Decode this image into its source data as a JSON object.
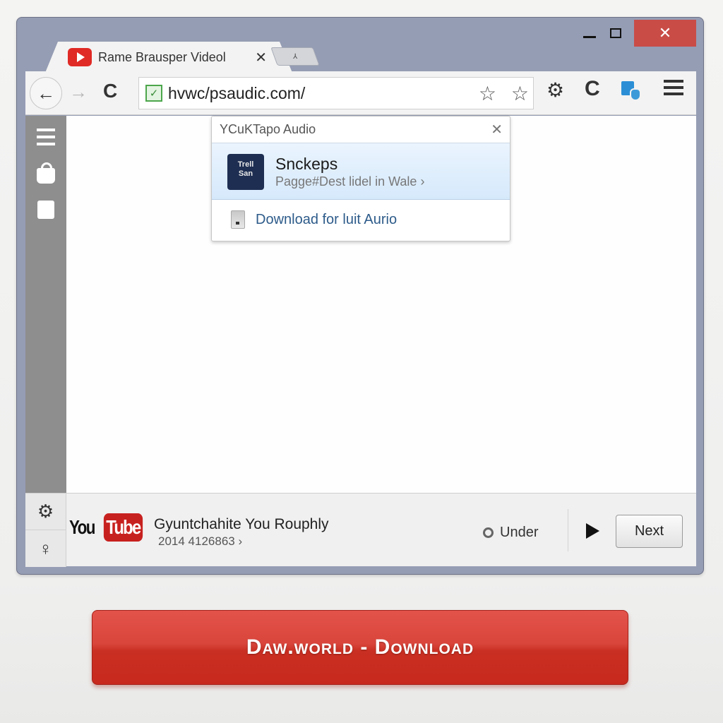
{
  "window": {
    "controls": {
      "minimize": "–",
      "maximize": "□",
      "close": "✕"
    }
  },
  "tabs": [
    {
      "title": "Rame Brausper Videol",
      "favicon": "youtube-play-icon",
      "close": "✕",
      "active": true
    },
    {
      "title": "",
      "new_tab_glyph": "⅄"
    }
  ],
  "toolbar": {
    "back": "←",
    "forward": "→",
    "reload": "C",
    "url": "hvwc/psaudic.com/",
    "secure_glyph": "✓",
    "bookmark_glyph": "☆",
    "settings_glyph": "⚙",
    "c_glyph": "C",
    "menu": "hamburger-menu-icon"
  },
  "sidebar": {
    "items": [
      "menu-icon",
      "bag-icon",
      "clipboard-icon"
    ]
  },
  "popup": {
    "title": "YCuKTapo Audio",
    "close": "✕",
    "item": {
      "thumb_text": "Trell\nSan",
      "title": "Snckeps",
      "subtitle": "Pagge#Dest lidel in Wale ›"
    },
    "download_label": "Download for luit Aurio"
  },
  "bottom_bar": {
    "side_icons": {
      "top": "⚙",
      "bottom": "♀"
    },
    "logo": {
      "you": "You",
      "tube": "Tube"
    },
    "video_title": "Gyuntchahite You Rouphly",
    "video_meta": "2014 4126863 ›",
    "radio_label": "Under",
    "next_label": "Next"
  },
  "download_button": {
    "label": "Daw.world - Download",
    "color": "#d23a2e"
  }
}
